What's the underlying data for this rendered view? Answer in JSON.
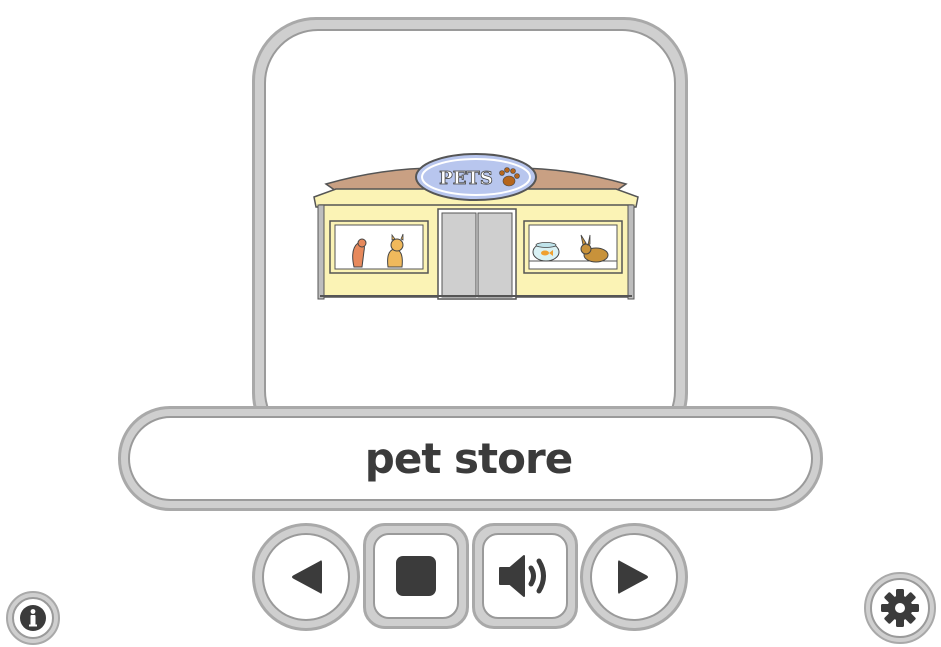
{
  "card": {
    "image_icon": "pet-store-illustration",
    "sign_text": "PETS"
  },
  "word": {
    "text": "pet store"
  },
  "controls": {
    "previous_icon": "triangle-left-icon",
    "stop_icon": "stop-square-icon",
    "sound_icon": "speaker-icon",
    "next_icon": "triangle-right-icon",
    "info_icon": "info-icon",
    "settings_icon": "gear-icon"
  },
  "colors": {
    "frame": "#cfcfcf",
    "frame_border": "#a9a9a9",
    "glyph": "#3b3b3b",
    "store_wall": "#fbf3b5",
    "store_roof": "#c9a083",
    "sign": "#b8c6ee"
  }
}
